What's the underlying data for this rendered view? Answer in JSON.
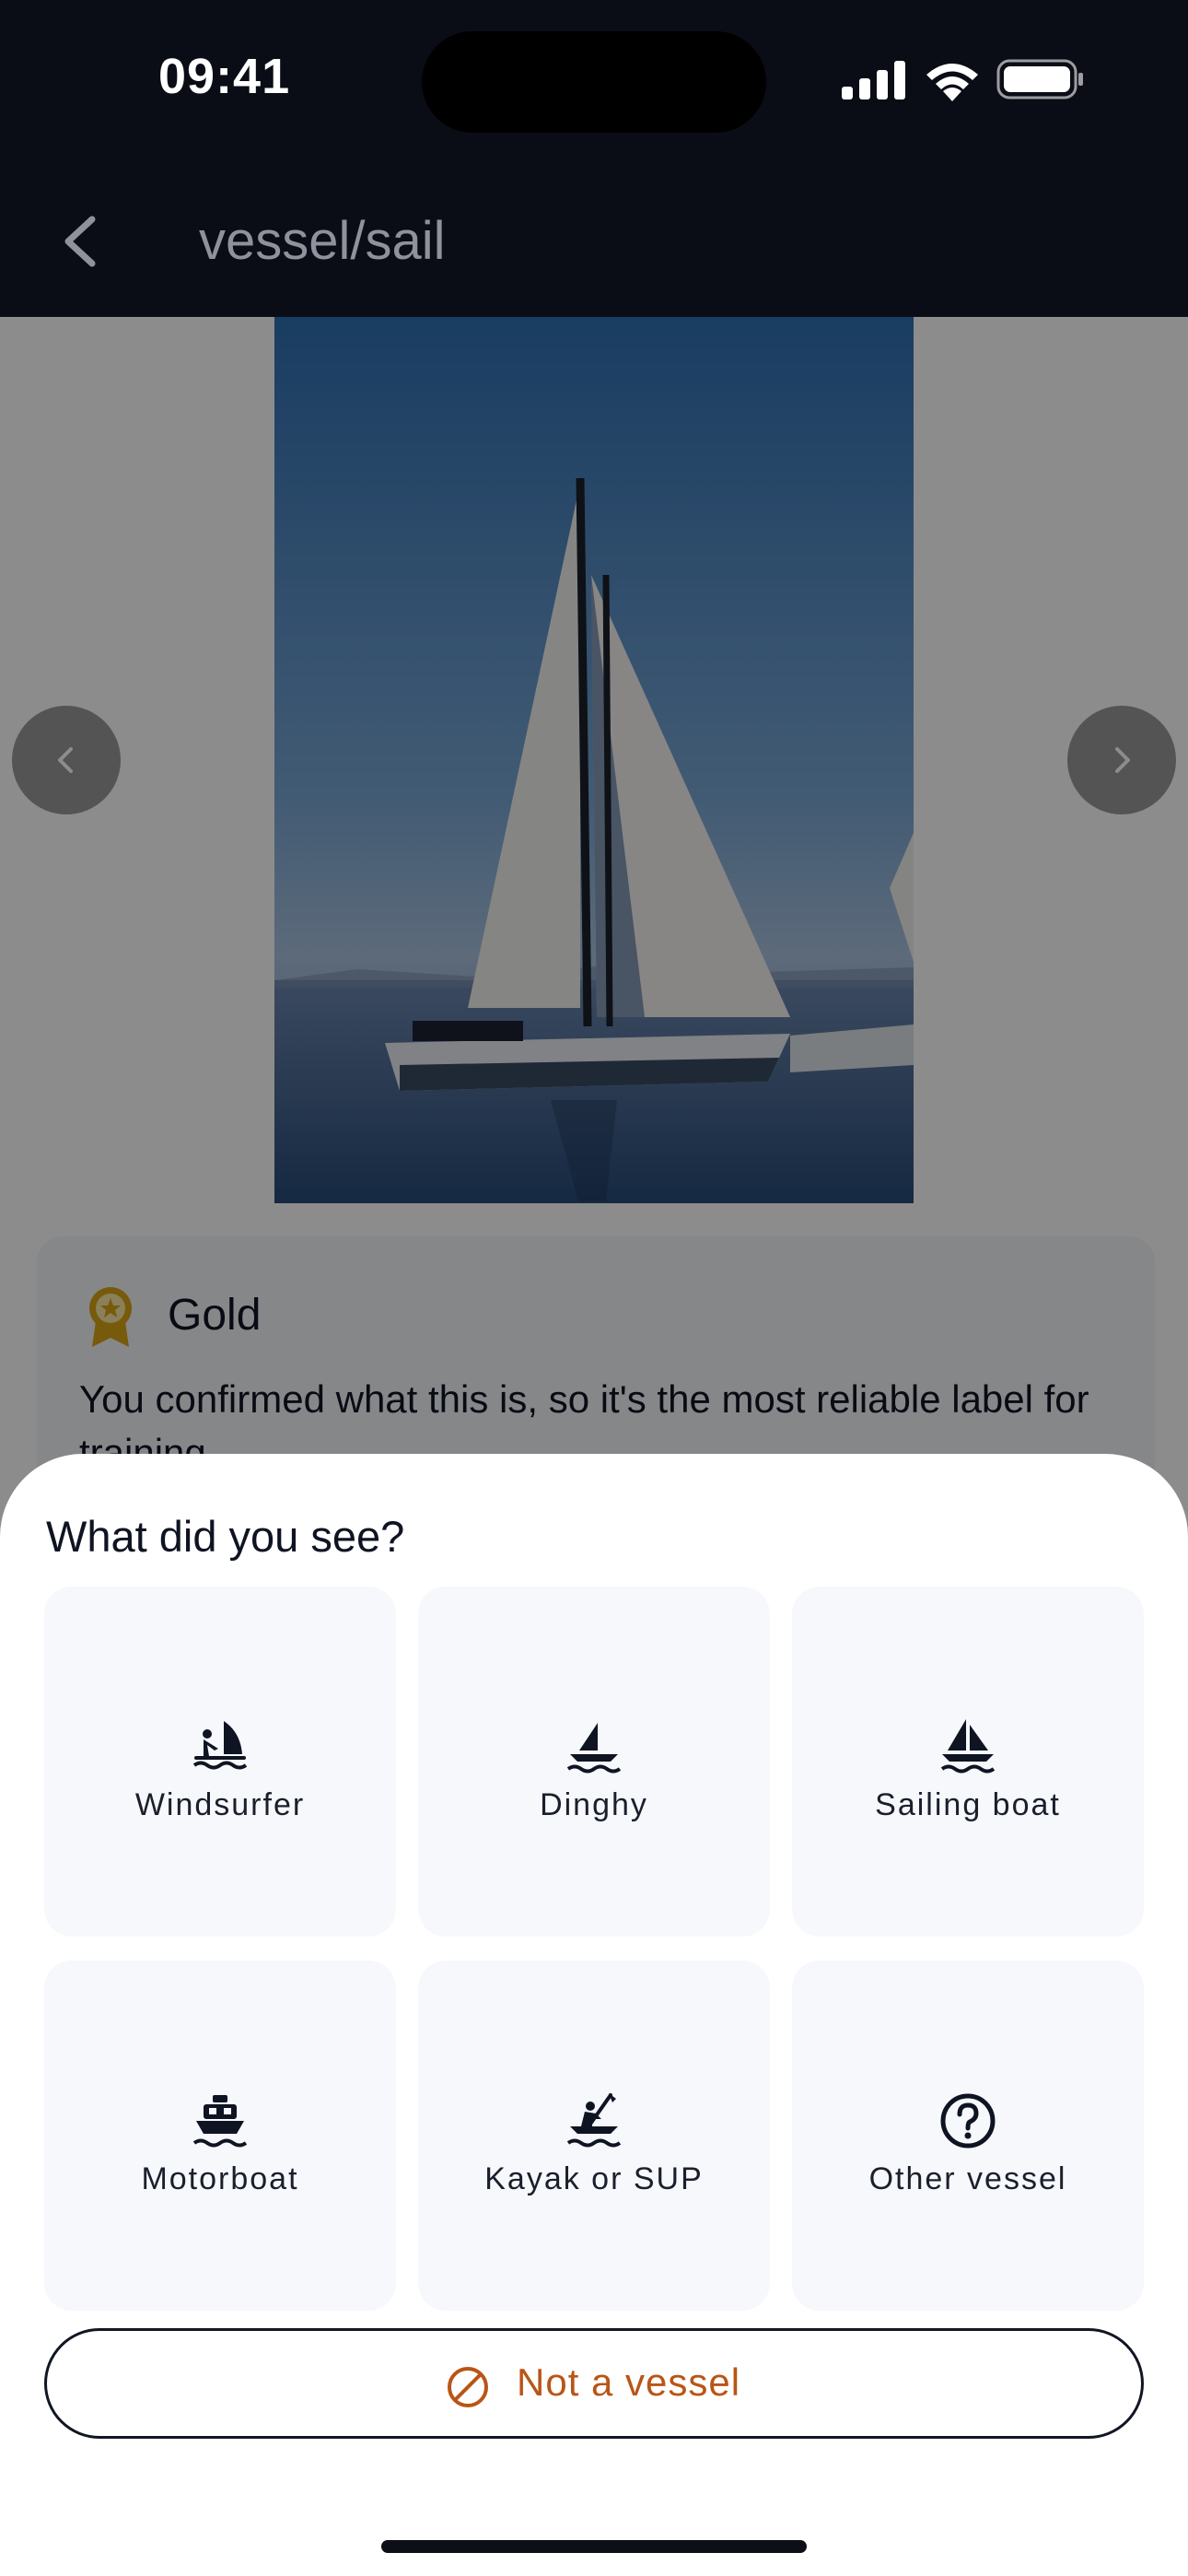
{
  "status_bar": {
    "time": "09:41",
    "icons": [
      "signal-icon",
      "wifi-icon",
      "battery-icon"
    ]
  },
  "nav": {
    "back_icon": "chevron-left-icon",
    "title": "vessel/sail"
  },
  "photo": {
    "subject": "sailing boat on water",
    "prev_icon": "chevron-left-icon",
    "next_icon": "chevron-right-icon"
  },
  "label_info": {
    "icon": "medal-icon",
    "tier": "Gold",
    "description": "You confirmed what this is, so it's the most reliable label for training."
  },
  "sheet": {
    "title": "What did you see?",
    "options": [
      {
        "label": "Windsurfer",
        "icon": "windsurfer-icon"
      },
      {
        "label": "Dinghy",
        "icon": "dinghy-icon"
      },
      {
        "label": "Sailing boat",
        "icon": "sailing-boat-icon"
      },
      {
        "label": "Motorboat",
        "icon": "motorboat-icon"
      },
      {
        "label": "Kayak or SUP",
        "icon": "kayak-icon"
      },
      {
        "label": "Other vessel",
        "icon": "question-circle-icon"
      }
    ],
    "not_vessel": {
      "label": "Not a vessel",
      "icon": "prohibited-icon"
    }
  },
  "colors": {
    "header_bg": "#0a0c16",
    "accent_orange": "#b95516",
    "medal_gold": "#d9a514",
    "option_bg": "#f6f8fb"
  }
}
